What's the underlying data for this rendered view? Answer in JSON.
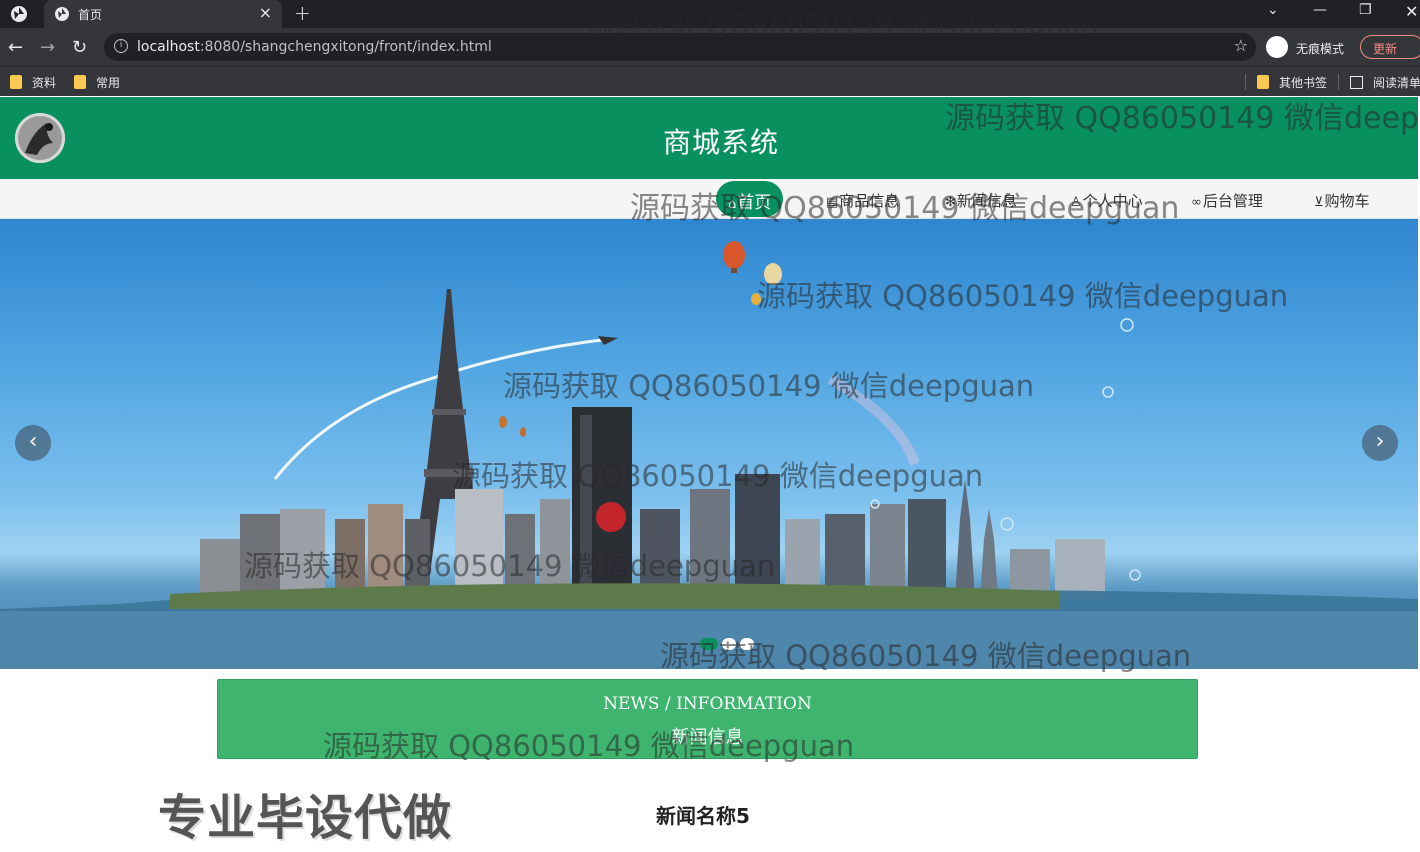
{
  "browser": {
    "tab_title": "首页",
    "url_host": "localhost",
    "url_rest": ":8080/shangchengxitong/front/index.html",
    "incognito_label": "无痕模式",
    "update_label": "更新",
    "bookmarks": [
      "资料",
      "常用",
      "其他书签",
      "阅读清单"
    ]
  },
  "site": {
    "title": "商城系统",
    "nav": [
      {
        "icon": "home-icon",
        "label": "首页"
      },
      {
        "icon": "goods-icon",
        "label": "商品信息"
      },
      {
        "icon": "news-icon",
        "label": "新闻信息"
      },
      {
        "icon": "user-icon",
        "label": "个人中心"
      },
      {
        "icon": "link-icon",
        "label": "后台管理"
      },
      {
        "icon": "cart-icon",
        "label": "购物车"
      }
    ],
    "news_section": {
      "en": "NEWS / INFORMATION",
      "cn": "新闻信息"
    },
    "news_item_title": "新闻名称5",
    "promo_text": "专业毕设代做"
  },
  "watermark": "源码获取 QQ86050149 微信deepguan",
  "colors": {
    "brand": "#09905f",
    "news_banner": "#3fb46f",
    "browser_dark": "#202124"
  }
}
